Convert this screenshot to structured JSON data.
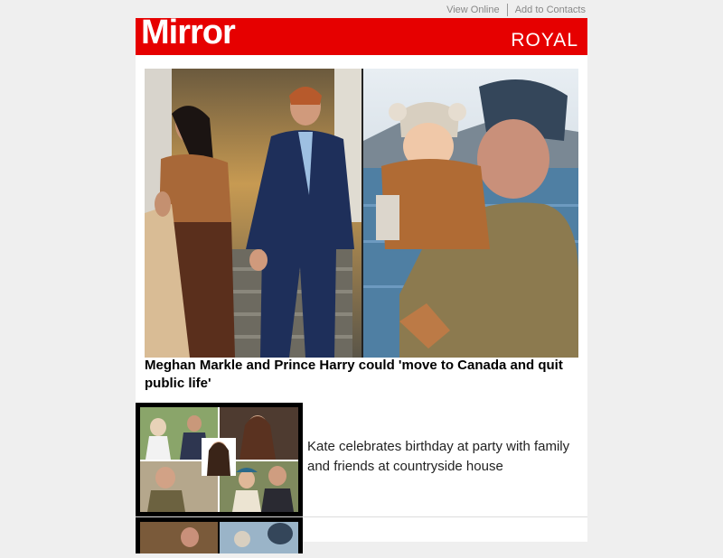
{
  "top_links": {
    "view_online": "View Online",
    "add_to_contacts": "Add to Contacts"
  },
  "header": {
    "brand": "Mirror",
    "section": "ROYAL",
    "brand_color": "#e60000"
  },
  "main_story": {
    "headline": "Meghan Markle and Prince Harry could 'move to Canada and quit public life'"
  },
  "stories": [
    {
      "title": "Kate celebrates birthday at party with family and friends at countryside house"
    }
  ]
}
